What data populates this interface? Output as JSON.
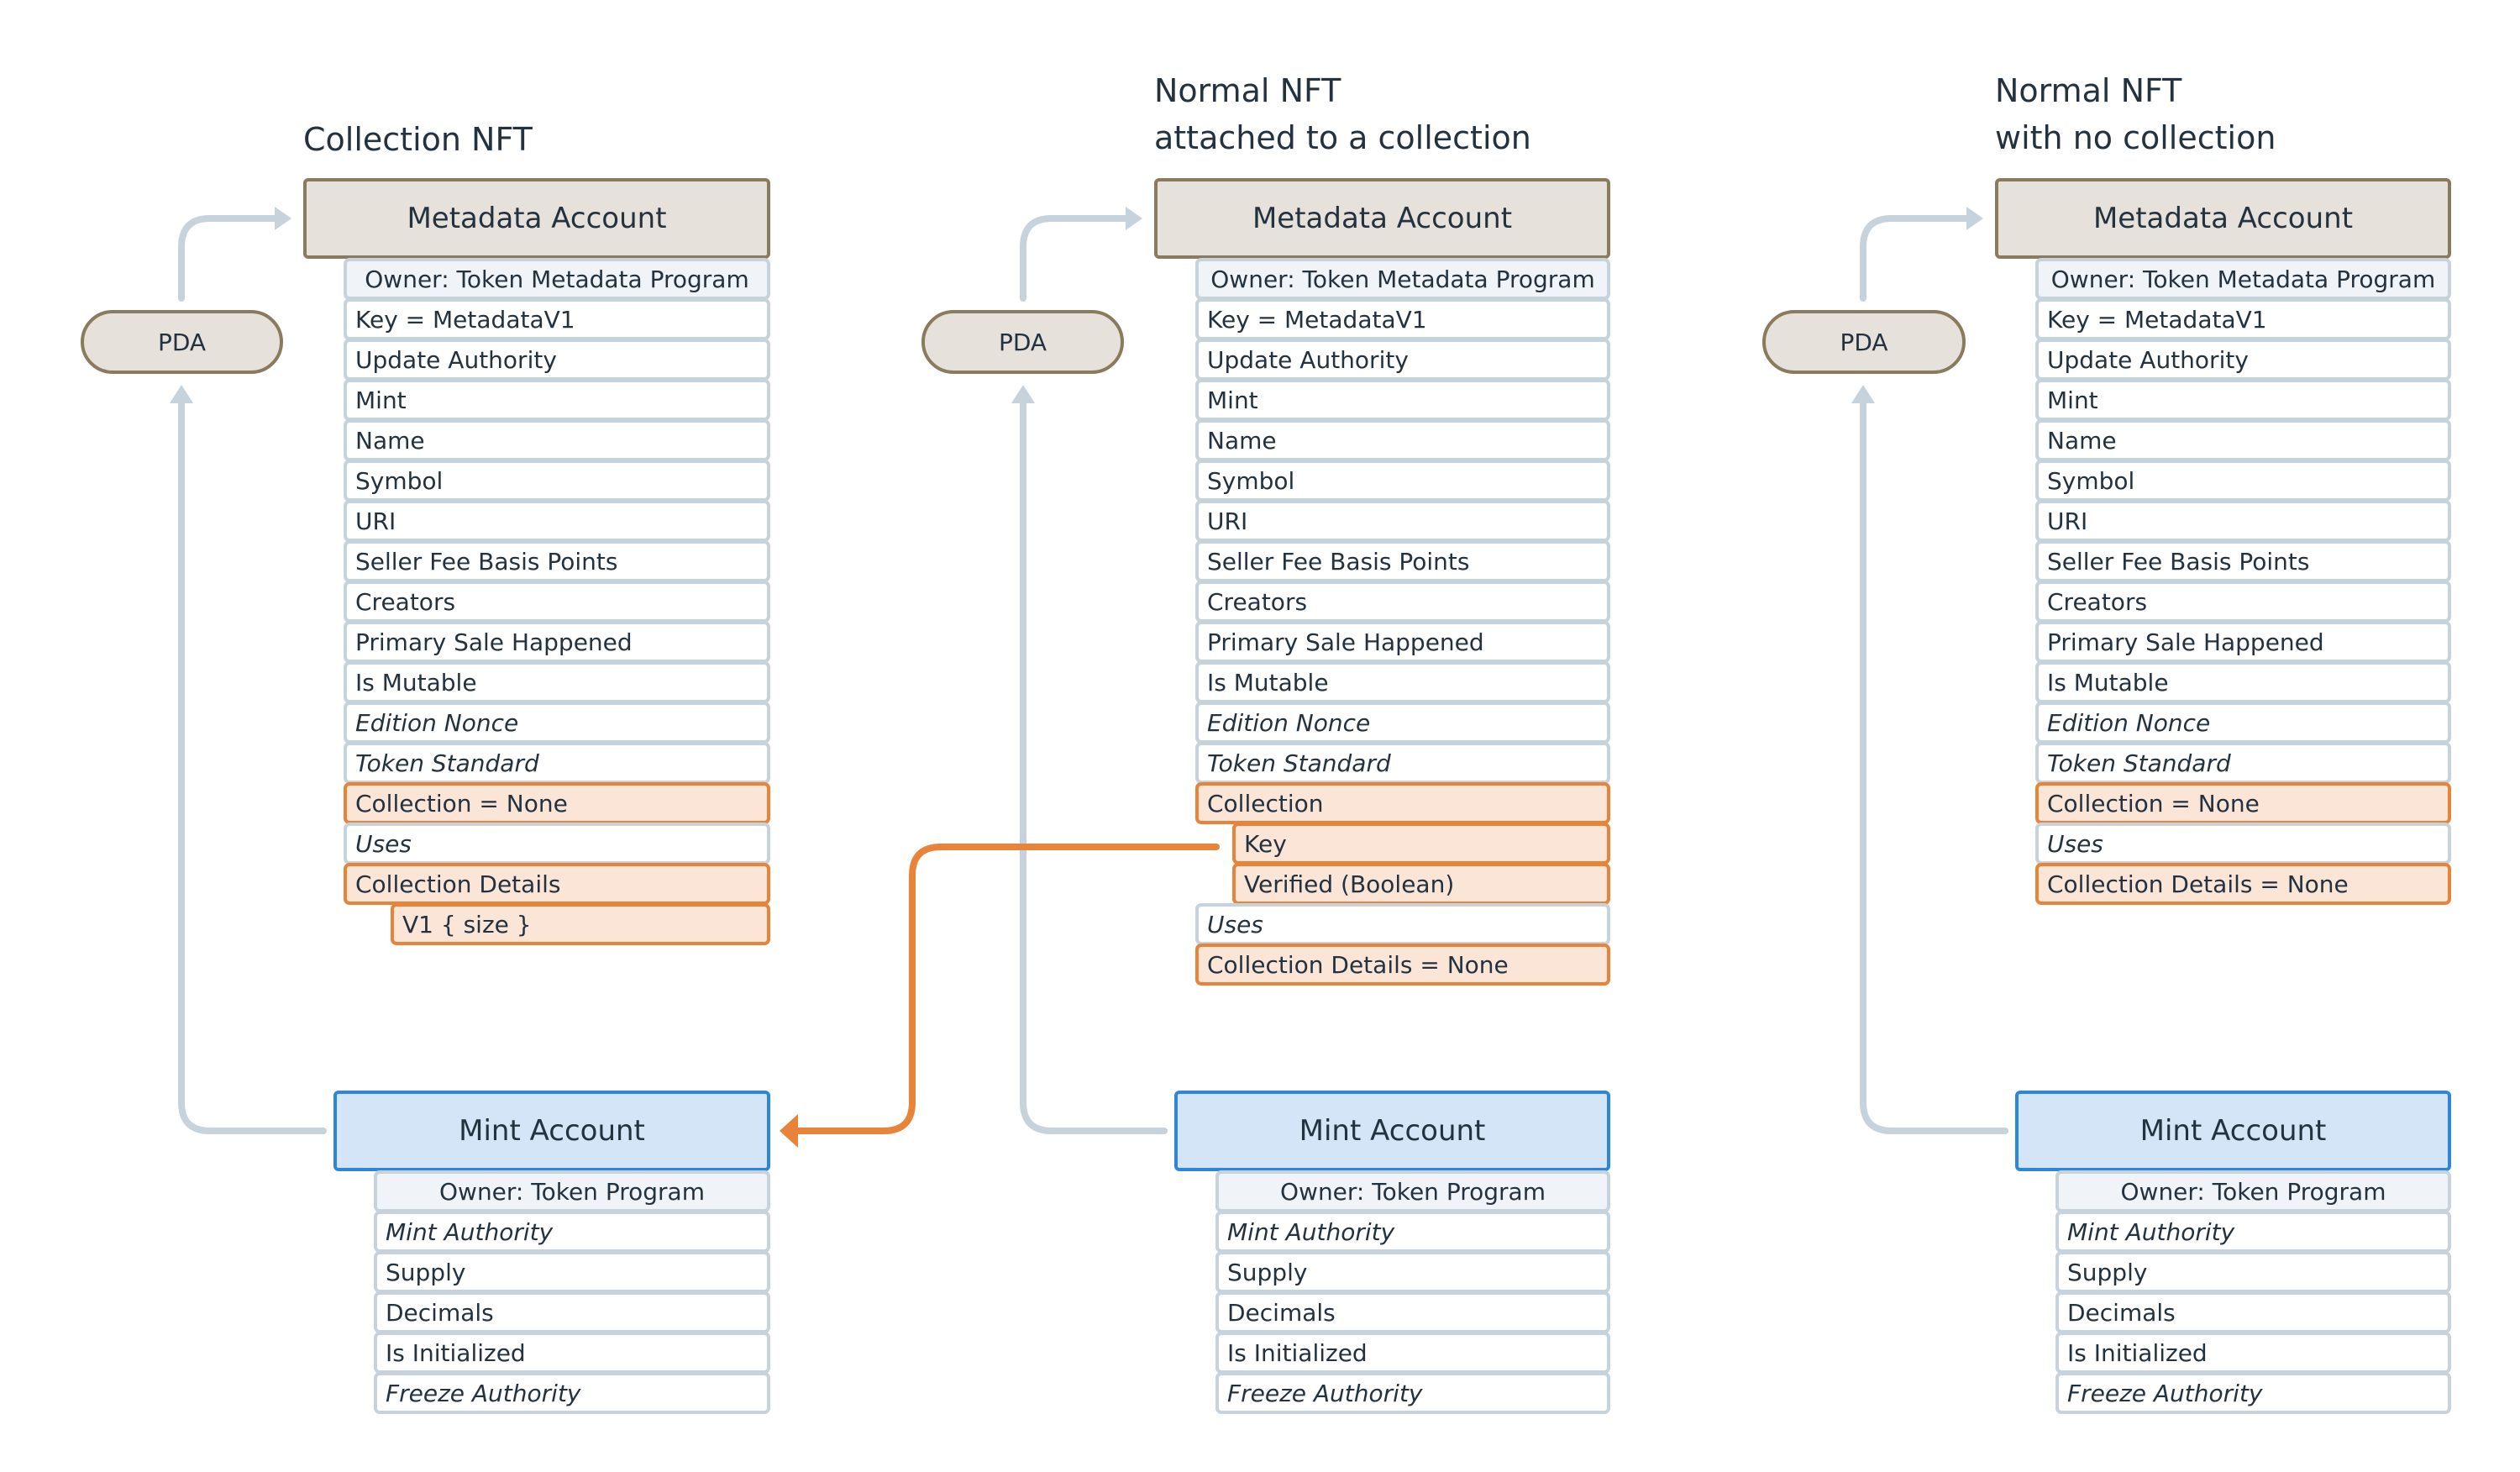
{
  "columns": [
    {
      "title": "Collection NFT",
      "pda_label": "PDA",
      "metadata": {
        "header": "Metadata Account",
        "rows": [
          {
            "label": "Owner: Token Metadata Program",
            "kind": "owner"
          },
          {
            "label": "Key = MetadataV1",
            "kind": "normal"
          },
          {
            "label": "Update Authority",
            "kind": "normal"
          },
          {
            "label": "Mint",
            "kind": "normal"
          },
          {
            "label": "Name",
            "kind": "normal"
          },
          {
            "label": "Symbol",
            "kind": "normal"
          },
          {
            "label": "URI",
            "kind": "normal"
          },
          {
            "label": "Seller Fee Basis Points",
            "kind": "normal"
          },
          {
            "label": "Creators",
            "kind": "normal"
          },
          {
            "label": "Primary Sale Happened",
            "kind": "normal"
          },
          {
            "label": "Is Mutable",
            "kind": "normal"
          },
          {
            "label": "Edition Nonce",
            "kind": "optional"
          },
          {
            "label": "Token Standard",
            "kind": "optional"
          },
          {
            "label": "Collection = None",
            "kind": "highlight"
          },
          {
            "label": "Uses",
            "kind": "optional"
          },
          {
            "label": "Collection Details",
            "kind": "highlight"
          },
          {
            "label": "V1 { size }",
            "kind": "highlight-sub"
          }
        ]
      },
      "mint": {
        "header": "Mint Account",
        "rows": [
          {
            "label": "Owner: Token Program",
            "kind": "owner"
          },
          {
            "label": "Mint Authority",
            "kind": "optional"
          },
          {
            "label": "Supply",
            "kind": "normal"
          },
          {
            "label": "Decimals",
            "kind": "normal"
          },
          {
            "label": "Is Initialized",
            "kind": "normal"
          },
          {
            "label": "Freeze Authority",
            "kind": "optional"
          }
        ]
      }
    },
    {
      "title": "Normal NFT\nattached to a collection",
      "pda_label": "PDA",
      "metadata": {
        "header": "Metadata Account",
        "rows": [
          {
            "label": "Owner: Token Metadata Program",
            "kind": "owner"
          },
          {
            "label": "Key = MetadataV1",
            "kind": "normal"
          },
          {
            "label": "Update Authority",
            "kind": "normal"
          },
          {
            "label": "Mint",
            "kind": "normal"
          },
          {
            "label": "Name",
            "kind": "normal"
          },
          {
            "label": "Symbol",
            "kind": "normal"
          },
          {
            "label": "URI",
            "kind": "normal"
          },
          {
            "label": "Seller Fee Basis Points",
            "kind": "normal"
          },
          {
            "label": "Creators",
            "kind": "normal"
          },
          {
            "label": "Primary Sale Happened",
            "kind": "normal"
          },
          {
            "label": "Is Mutable",
            "kind": "normal"
          },
          {
            "label": "Edition Nonce",
            "kind": "optional"
          },
          {
            "label": "Token Standard",
            "kind": "optional"
          },
          {
            "label": "Collection",
            "kind": "highlight"
          },
          {
            "label": "Key",
            "kind": "highlight-sub"
          },
          {
            "label": "Verified (Boolean)",
            "kind": "highlight-sub"
          },
          {
            "label": "Uses",
            "kind": "optional"
          },
          {
            "label": "Collection Details = None",
            "kind": "highlight"
          }
        ]
      },
      "mint": {
        "header": "Mint Account",
        "rows": [
          {
            "label": "Owner: Token Program",
            "kind": "owner"
          },
          {
            "label": "Mint Authority",
            "kind": "optional"
          },
          {
            "label": "Supply",
            "kind": "normal"
          },
          {
            "label": "Decimals",
            "kind": "normal"
          },
          {
            "label": "Is Initialized",
            "kind": "normal"
          },
          {
            "label": "Freeze Authority",
            "kind": "optional"
          }
        ]
      }
    },
    {
      "title": "Normal NFT\nwith no collection",
      "pda_label": "PDA",
      "metadata": {
        "header": "Metadata Account",
        "rows": [
          {
            "label": "Owner: Token Metadata Program",
            "kind": "owner"
          },
          {
            "label": "Key = MetadataV1",
            "kind": "normal"
          },
          {
            "label": "Update Authority",
            "kind": "normal"
          },
          {
            "label": "Mint",
            "kind": "normal"
          },
          {
            "label": "Name",
            "kind": "normal"
          },
          {
            "label": "Symbol",
            "kind": "normal"
          },
          {
            "label": "URI",
            "kind": "normal"
          },
          {
            "label": "Seller Fee Basis Points",
            "kind": "normal"
          },
          {
            "label": "Creators",
            "kind": "normal"
          },
          {
            "label": "Primary Sale Happened",
            "kind": "normal"
          },
          {
            "label": "Is Mutable",
            "kind": "normal"
          },
          {
            "label": "Edition Nonce",
            "kind": "optional"
          },
          {
            "label": "Token Standard",
            "kind": "optional"
          },
          {
            "label": "Collection = None",
            "kind": "highlight"
          },
          {
            "label": "Uses",
            "kind": "optional"
          },
          {
            "label": "Collection Details = None",
            "kind": "highlight"
          }
        ]
      },
      "mint": {
        "header": "Mint Account",
        "rows": [
          {
            "label": "Owner: Token Program",
            "kind": "owner"
          },
          {
            "label": "Mint Authority",
            "kind": "optional"
          },
          {
            "label": "Supply",
            "kind": "normal"
          },
          {
            "label": "Decimals",
            "kind": "normal"
          },
          {
            "label": "Is Initialized",
            "kind": "normal"
          },
          {
            "label": "Freeze Authority",
            "kind": "optional"
          }
        ]
      }
    }
  ],
  "connections": [
    {
      "from": "Normal NFT attached to a collection: Collection.Key",
      "to": "Collection NFT: Mint Account",
      "color": "#e8843a"
    }
  ],
  "colors": {
    "metadata_fill": "#e6e2db",
    "metadata_border": "#8a7a5e",
    "mint_fill": "#d3e5f6",
    "mint_border": "#2e86d8",
    "highlight_fill": "#fae5d7",
    "highlight_border": "#e8843a",
    "row_border": "#c6d2dc",
    "connector_grey": "#c6d2dc",
    "text": "#24323f"
  }
}
